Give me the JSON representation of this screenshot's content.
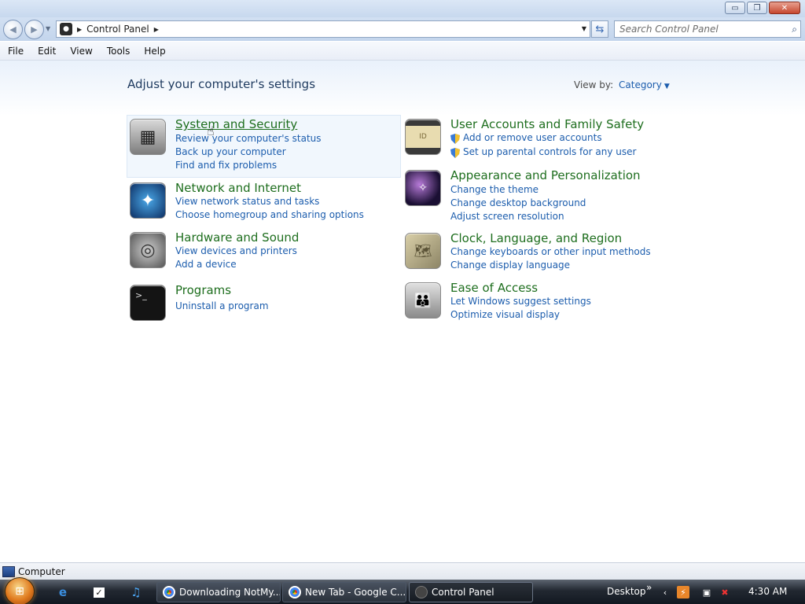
{
  "window": {
    "controls": {
      "minimize": "▭",
      "maximize": "❐",
      "close": "✕"
    }
  },
  "address_bar": {
    "crumb": "Control Panel",
    "search_placeholder": "Search Control Panel"
  },
  "menu": [
    "File",
    "Edit",
    "View",
    "Tools",
    "Help"
  ],
  "main": {
    "heading": "Adjust your computer's settings",
    "view_by_label": "View by:",
    "view_by_value": "Category"
  },
  "categories": [
    {
      "title": "System and Security",
      "icon": "vault-icon",
      "links": [
        "Review your computer's status",
        "Back up your computer",
        "Find and fix problems"
      ]
    },
    {
      "title": "Network and Internet",
      "icon": "globe-compass-icon",
      "links": [
        "View network status and tasks",
        "Choose homegroup and sharing options"
      ]
    },
    {
      "title": "Hardware and Sound",
      "icon": "dvd-speaker-icon",
      "links": [
        "View devices and printers",
        "Add a device"
      ]
    },
    {
      "title": "Programs",
      "icon": "terminal-icon",
      "links": [
        "Uninstall a program"
      ]
    },
    {
      "title": "User Accounts and Family Safety",
      "icon": "id-card-icon",
      "links": [
        "Add or remove user accounts",
        "Set up parental controls for any user"
      ]
    },
    {
      "title": "Appearance and Personalization",
      "icon": "monitor-galaxy-icon",
      "links": [
        "Change the theme",
        "Change desktop background",
        "Adjust screen resolution"
      ]
    },
    {
      "title": "Clock, Language, and Region",
      "icon": "world-map-icon",
      "links": [
        "Change keyboards or other input methods",
        "Change display language"
      ]
    },
    {
      "title": "Ease of Access",
      "icon": "people-icon",
      "links": [
        "Let Windows suggest settings",
        "Optimize visual display"
      ]
    }
  ],
  "status_bar": {
    "text": "Computer"
  },
  "taskbar": {
    "tasks": [
      "Downloading NotMy...",
      "New Tab - Google C...",
      "Control Panel"
    ],
    "desktop_label": "Desktop",
    "more": "»",
    "clock": "4:30 AM"
  },
  "colors": {
    "link": "#1c5dad",
    "category_title": "#1e6e1e",
    "heading": "#1e3a5f"
  }
}
